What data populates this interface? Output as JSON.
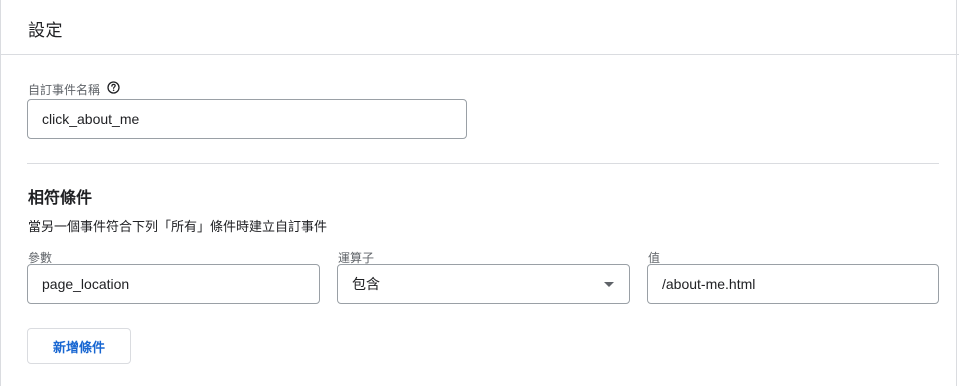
{
  "header": {
    "title": "設定"
  },
  "event_name": {
    "label": "自訂事件名稱",
    "help_icon": "help-circle-icon",
    "value": "click_about_me"
  },
  "conditions": {
    "title": "相符條件",
    "description": "當另一個事件符合下列「所有」條件時建立自訂事件",
    "parameter": {
      "label": "參數",
      "value": "page_location"
    },
    "operator": {
      "label": "運算子",
      "value": "包含",
      "icon": "dropdown-arrow-icon"
    },
    "value": {
      "label": "值",
      "value": "/about-me.html"
    },
    "add_button_label": "新增條件"
  },
  "colors": {
    "accent": "#1967d2",
    "border": "#dadce0",
    "input_border": "#9aa0a6",
    "label": "#5f6368"
  }
}
